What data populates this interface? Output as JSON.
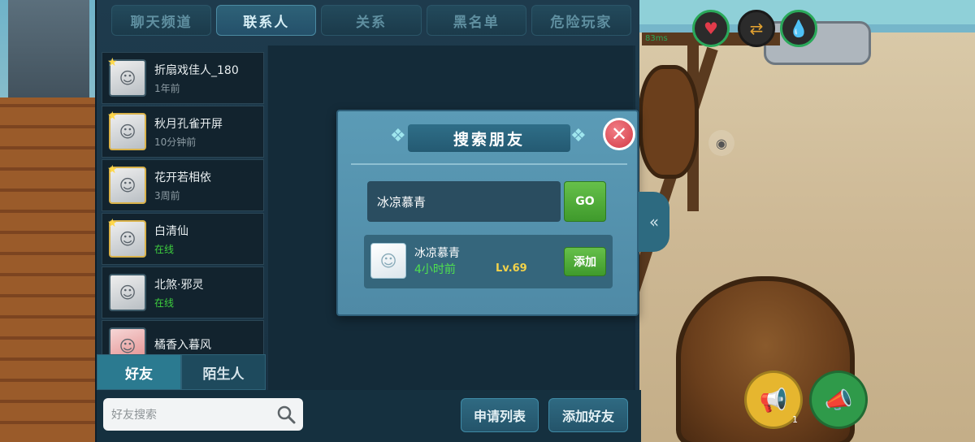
{
  "tabs": [
    {
      "label": "聊天频道",
      "active": false
    },
    {
      "label": "联系人",
      "active": true
    },
    {
      "label": "关系",
      "active": false
    },
    {
      "label": "黑名单",
      "active": false
    },
    {
      "label": "危险玩家",
      "active": false
    }
  ],
  "friends": [
    {
      "name": "折扇戏佳人_180",
      "status": "1年前",
      "online": false
    },
    {
      "name": "秋月孔雀开屏",
      "status": "10分钟前",
      "online": false
    },
    {
      "name": "花开若相依",
      "status": "3周前",
      "online": false
    },
    {
      "name": "白清仙",
      "status": "在线",
      "online": true
    },
    {
      "name": "北煞·邪灵",
      "status": "在线",
      "online": true
    },
    {
      "name": "橘香入暮风",
      "status": "",
      "online": false
    }
  ],
  "bottom_tabs": [
    {
      "label": "好友",
      "active": true
    },
    {
      "label": "陌生人",
      "active": false
    }
  ],
  "search": {
    "placeholder": "好友搜索"
  },
  "actions": {
    "apply_list": "申请列表",
    "add_friend": "添加好友"
  },
  "modal": {
    "title": "搜索朋友",
    "input_value": "冰凉慕青",
    "go_label": "GO",
    "result": {
      "name": "冰凉慕青",
      "time": "4小时前",
      "level": "Lv.69",
      "add_label": "添加"
    }
  },
  "hud": {
    "ping": "83ms",
    "megaphone_count": "1"
  },
  "colors": {
    "accent": "#2b7a90",
    "online": "#3ecf3e",
    "go": "#4fae38",
    "close": "#d23a45"
  }
}
